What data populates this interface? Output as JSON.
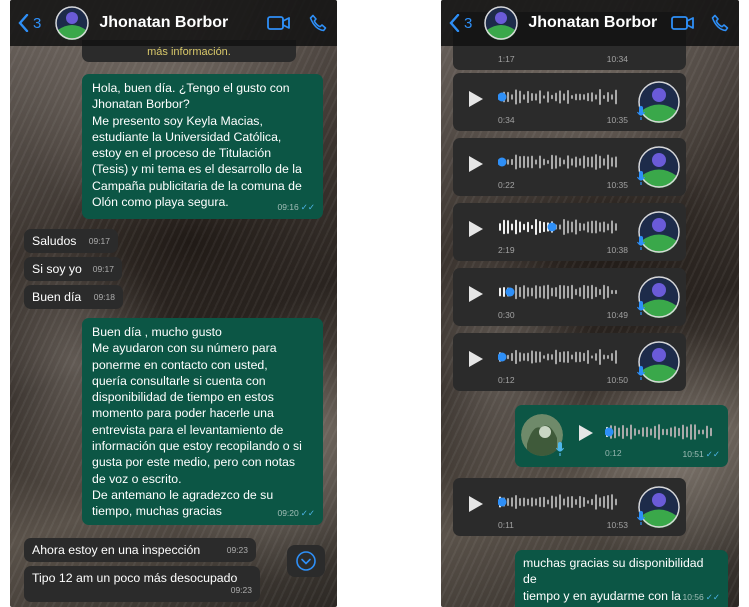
{
  "left": {
    "back_count": "3",
    "contact_name": "Jhonatan Borbor",
    "top_snippet": "más información.",
    "messages": [
      {
        "text": "Hola, buen día. ¿Tengo el gusto con\nJhonatan Borbor?\nMe presento soy Keyla Macias,\nestudiante la Universidad Católica,\nestoy en el proceso de Titulación\n(Tesis) y mi tema es el desarrollo de la\nCampaña publicitaria de la comuna de\nOlón como playa segura.",
        "time": "09:16"
      },
      {
        "text": "Saludos",
        "time": "09:17"
      },
      {
        "text": "Si soy yo",
        "time": "09:17"
      },
      {
        "text": "Buen día",
        "time": "09:18"
      },
      {
        "text": "Buen día , mucho gusto\nMe ayudaron con su número para\nponerme en contacto con usted,\nquería consultarle si cuenta con\ndisponibilidad de tiempo en estos\nmomento para poder hacerle una\nentrevista para el levantamiento de\ninformación que estoy recopilando o si\ngusta por este medio, pero con notas\nde voz o escrito.\nDe antemano le agradezco de su\ntiempo, muchas gracias",
        "time": "09:20"
      },
      {
        "text": "Ahora estoy en una inspección",
        "time": "09:23"
      },
      {
        "text": "Tipo 12 am un poco más desocupado",
        "time": "09:23"
      }
    ]
  },
  "right": {
    "back_count": "3",
    "contact_name": "Jhonatan Borbor",
    "voice_notes": [
      {
        "duration": "1:17",
        "time": "10:34"
      },
      {
        "duration": "0:34",
        "time": "10:35",
        "progress": 0.02
      },
      {
        "duration": "0:22",
        "time": "10:35",
        "progress": 0.02
      },
      {
        "duration": "2:19",
        "time": "10:38",
        "progress": 0.45
      },
      {
        "duration": "0:30",
        "time": "10:49",
        "progress": 0.1
      },
      {
        "duration": "0:12",
        "time": "10:50",
        "progress": 0.02
      },
      {
        "duration": "0:12",
        "time": "10:51",
        "progress": 0.02
      },
      {
        "duration": "0:11",
        "time": "10:53",
        "progress": 0.02
      }
    ],
    "final_message": {
      "text": "muchas gracias su disponibilidad de\ntiempo y en ayudarme con la\ninformación",
      "time": "10:56"
    }
  },
  "colors": {
    "outgoing": "#0c5645",
    "incoming": "#2b2b2b",
    "accent": "#2e8ff7",
    "read_tick": "#4fb7ec"
  },
  "icons": [
    "back-chevron-icon",
    "video-call-icon",
    "phone-call-icon",
    "play-icon",
    "mic-icon",
    "scroll-down-icon"
  ]
}
